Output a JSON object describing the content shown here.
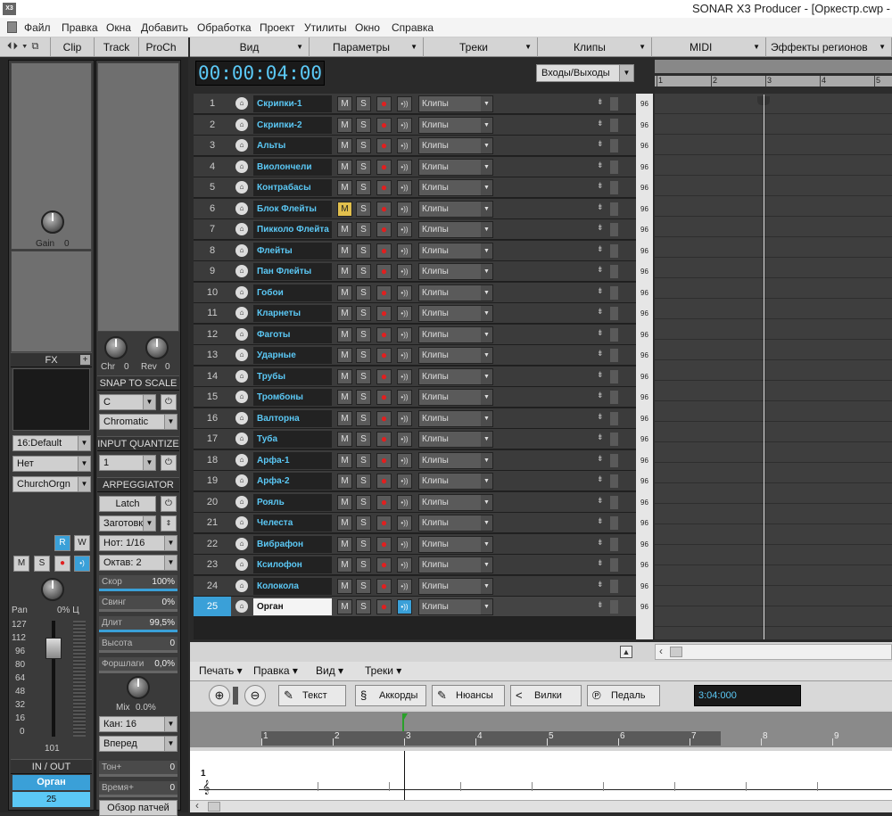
{
  "window": {
    "title": "SONAR X3 Producer - [Оркестр.cwp -",
    "logo": "X3"
  },
  "menubar": [
    "Файл",
    "Правка",
    "Окна",
    "Добавить",
    "Обработка",
    "Проект",
    "Утилиты",
    "Окно",
    "Справка"
  ],
  "inspector": {
    "tabs": {
      "icons": "⏴⏵ ▾ ⧉",
      "clip": "Clip",
      "track": "Track",
      "proch": "ProCh"
    },
    "gain_label": "Gain",
    "gain_value": "0",
    "chr_label": "Chr",
    "chr_value": "0",
    "rev_label": "Rev",
    "rev_value": "0",
    "fx_label": "FX",
    "bank": "16:Default",
    "patch_none": "Нет",
    "patch_name": "ChurchOrgn",
    "snap_to_scale": "SNAP TO SCALE",
    "scale_root": "C",
    "scale_type": "Chromatic",
    "input_quantize": "INPUT QUANTIZE",
    "iq_value": "1",
    "arpeggiator": "ARPEGGIATOR",
    "latch": "Latch",
    "preset": "Заготовк",
    "note": "Нот: 1/16",
    "octave": "Октав: 2",
    "params": [
      {
        "label": "Скор",
        "value": "100%"
      },
      {
        "label": "Свинг",
        "value": "0%"
      },
      {
        "label": "Длит",
        "value": "99,5%"
      },
      {
        "label": "Высота",
        "value": "0"
      },
      {
        "label": "Форшлаги",
        "value": "0,0%"
      }
    ],
    "mix_label": "Mix",
    "mix_value": "0.0%",
    "channel": "Кан: 16",
    "direction": "Вперед",
    "tone_label": "Тон+",
    "tone_value": "0",
    "time_label": "Время+",
    "time_value": "0",
    "patch_browser": "Обзор патчей",
    "rw": {
      "r": "R",
      "w": "W"
    },
    "msr": {
      "m": "M",
      "s": "S"
    },
    "pan_label": "Pan",
    "pan_value": "0% Ц",
    "fader_scale": [
      "127",
      "112",
      "96",
      "80",
      "64",
      "48",
      "32",
      "16",
      "0"
    ],
    "fader_value": "101",
    "in_out": "IN / OUT",
    "track_name": "Орган",
    "track_number": "25"
  },
  "trackview": {
    "menu": [
      "Вид",
      "Параметры",
      "Треки",
      "Клипы",
      "MIDI",
      "Эффекты регионов"
    ],
    "time": "00:00:04:00",
    "io_button": "Входы/Выходы",
    "clip_label": "Клипы",
    "m": "M",
    "s": "S",
    "tracks": [
      {
        "num": "1",
        "name": "Скрипки-1"
      },
      {
        "num": "2",
        "name": "Скрипки-2"
      },
      {
        "num": "3",
        "name": "Альты"
      },
      {
        "num": "4",
        "name": "Виолончели"
      },
      {
        "num": "5",
        "name": "Контрабасы"
      },
      {
        "num": "6",
        "name": "Блок Флейты"
      },
      {
        "num": "7",
        "name": "Пикколо Флейта"
      },
      {
        "num": "8",
        "name": "Флейты"
      },
      {
        "num": "9",
        "name": "Пан Флейты"
      },
      {
        "num": "10",
        "name": "Гобои"
      },
      {
        "num": "11",
        "name": "Кларнеты"
      },
      {
        "num": "12",
        "name": "Фаготы"
      },
      {
        "num": "13",
        "name": "Ударные"
      },
      {
        "num": "14",
        "name": "Трубы"
      },
      {
        "num": "15",
        "name": "Тромбоны"
      },
      {
        "num": "16",
        "name": "Валторна"
      },
      {
        "num": "17",
        "name": "Туба"
      },
      {
        "num": "18",
        "name": "Арфа-1"
      },
      {
        "num": "19",
        "name": "Арфа-2"
      },
      {
        "num": "20",
        "name": "Рояль"
      },
      {
        "num": "21",
        "name": "Челеста"
      },
      {
        "num": "22",
        "name": "Вибрафон"
      },
      {
        "num": "23",
        "name": "Ксилофон"
      },
      {
        "num": "24",
        "name": "Колокола"
      },
      {
        "num": "25",
        "name": "Орган"
      }
    ],
    "ppq": "96",
    "ruler": [
      "1",
      "2",
      "3",
      "4",
      "5"
    ]
  },
  "staffview": {
    "menu": [
      "Печать",
      "Правка",
      "Вид",
      "Треки"
    ],
    "tools": {
      "text": "Текст",
      "chords": "Аккорды",
      "nuances": "Нюансы",
      "hairpins": "Вилки",
      "pedal": "Педаль"
    },
    "time": "3:04:000",
    "ruler": [
      "1",
      "2",
      "3",
      "4",
      "5",
      "6",
      "7",
      "8",
      "9"
    ],
    "measure": "1"
  },
  "colors": {
    "accent": "#3aa0d8",
    "track_name": "#5bc8f5",
    "mute_on": "#e2c04d",
    "record": "#e02020"
  }
}
